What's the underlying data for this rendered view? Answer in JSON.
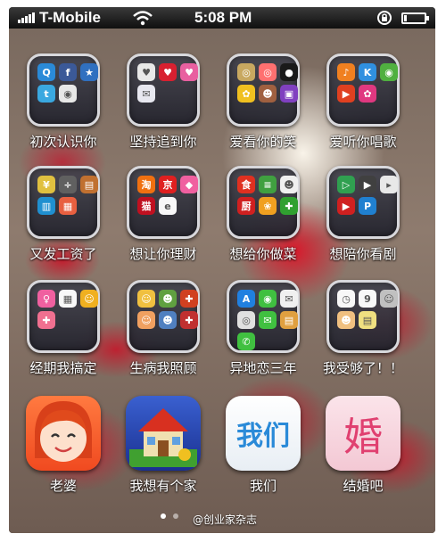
{
  "status_bar": {
    "carrier": "T-Mobile",
    "time": "5:08 PM",
    "battery_level": 0.15
  },
  "folders": [
    {
      "label": "初次认识你",
      "icons": [
        {
          "name": "qq-icon",
          "color": "#2a8ad8",
          "glyph": "Q"
        },
        {
          "name": "facebook-icon",
          "color": "#3b5998",
          "glyph": "f"
        },
        {
          "name": "star-icon",
          "color": "#3070c0",
          "glyph": "★"
        },
        {
          "name": "twitter-icon",
          "color": "#3aa8e0",
          "glyph": "t"
        },
        {
          "name": "owl-icon",
          "color": "#e8e8e8",
          "glyph": "◉"
        }
      ]
    },
    {
      "label": "坚持追到你",
      "icons": [
        {
          "name": "heart-message-icon",
          "color": "#e8e8e8",
          "glyph": "♥"
        },
        {
          "name": "heart-red-icon",
          "color": "#d82030",
          "glyph": "♥"
        },
        {
          "name": "pink-card-icon",
          "color": "#e860a0",
          "glyph": "♥"
        },
        {
          "name": "sms-icon",
          "color": "#e8e8f0",
          "glyph": "✉"
        }
      ]
    },
    {
      "label": "爱看你的笑",
      "icons": [
        {
          "name": "camera-icon",
          "color": "#c8a860",
          "glyph": "◎"
        },
        {
          "name": "beauty-camera-icon",
          "color": "#ff7070",
          "glyph": "◎"
        },
        {
          "name": "lens-icon",
          "color": "#1a1a1a",
          "glyph": "●"
        },
        {
          "name": "sunflower-icon",
          "color": "#f0c020",
          "glyph": "✿"
        },
        {
          "name": "monkey-icon",
          "color": "#a06040",
          "glyph": "☻"
        },
        {
          "name": "photo-icon",
          "color": "#8040c0",
          "glyph": "▣"
        }
      ]
    },
    {
      "label": "爱听你唱歌",
      "icons": [
        {
          "name": "music-icon",
          "color": "#f08020",
          "glyph": "♪"
        },
        {
          "name": "k-song-icon",
          "color": "#3090e0",
          "glyph": "K"
        },
        {
          "name": "record-icon",
          "color": "#50b040",
          "glyph": "◉"
        },
        {
          "name": "player-icon",
          "color": "#e04020",
          "glyph": "▶"
        },
        {
          "name": "flower-music-icon",
          "color": "#e03880",
          "glyph": "✿"
        }
      ]
    },
    {
      "label": "又发工资了",
      "icons": [
        {
          "name": "yen-icon",
          "color": "#e0c040",
          "glyph": "¥"
        },
        {
          "name": "calc-icon",
          "color": "#606060",
          "glyph": "÷"
        },
        {
          "name": "wallet-icon",
          "color": "#c07030",
          "glyph": "▤"
        },
        {
          "name": "bank-icon",
          "color": "#2090d0",
          "glyph": "▥"
        },
        {
          "name": "shop-icon",
          "color": "#e86040",
          "glyph": "▦"
        }
      ]
    },
    {
      "label": "想让你理财",
      "icons": [
        {
          "name": "taobao-icon",
          "color": "#f07010",
          "glyph": "淘"
        },
        {
          "name": "jd-icon",
          "color": "#e02020",
          "glyph": "京"
        },
        {
          "name": "pink-shop-icon",
          "color": "#f060a0",
          "glyph": "◆"
        },
        {
          "name": "tmall-icon",
          "color": "#c01020",
          "glyph": "猫"
        },
        {
          "name": "ebay-icon",
          "color": "#f8f8f8",
          "glyph": "e"
        }
      ]
    },
    {
      "label": "想给你做菜",
      "icons": [
        {
          "name": "recipe-icon",
          "color": "#e03020",
          "glyph": "食"
        },
        {
          "name": "menu-icon",
          "color": "#40a040",
          "glyph": "≡"
        },
        {
          "name": "panda-icon",
          "color": "#f0f0f0",
          "glyph": "☻"
        },
        {
          "name": "kitchen-icon",
          "color": "#d02020",
          "glyph": "厨"
        },
        {
          "name": "veggie-icon",
          "color": "#f0a020",
          "glyph": "❀"
        },
        {
          "name": "cook-icon",
          "color": "#30a030",
          "glyph": "✚"
        }
      ]
    },
    {
      "label": "想陪你看剧",
      "icons": [
        {
          "name": "tv-icon",
          "color": "#30a050",
          "glyph": "▷"
        },
        {
          "name": "clapper-icon",
          "color": "#404040",
          "glyph": "▶"
        },
        {
          "name": "video-icon",
          "color": "#e8e8e8",
          "glyph": "▸"
        },
        {
          "name": "youtube-icon",
          "color": "#d02020",
          "glyph": "▶"
        },
        {
          "name": "p-video-icon",
          "color": "#2080d0",
          "glyph": "P"
        }
      ]
    },
    {
      "label": "经期我搞定",
      "icons": [
        {
          "name": "period-tracker-icon",
          "color": "#f060a0",
          "glyph": "♀"
        },
        {
          "name": "calendar-pink-icon",
          "color": "#f8f8f8",
          "glyph": "▦"
        },
        {
          "name": "girl-icon",
          "color": "#f0b020",
          "glyph": "☺"
        },
        {
          "name": "health-icon",
          "color": "#f07090",
          "glyph": "✚"
        }
      ]
    },
    {
      "label": "生病我照顾",
      "icons": [
        {
          "name": "doctor-icon",
          "color": "#f0c040",
          "glyph": "☺"
        },
        {
          "name": "game-char-icon",
          "color": "#60a040",
          "glyph": "☻"
        },
        {
          "name": "medicine-icon",
          "color": "#d04020",
          "glyph": "✚"
        },
        {
          "name": "nurse-icon",
          "color": "#f0a060",
          "glyph": "☺"
        },
        {
          "name": "cartoon-icon",
          "color": "#5080c0",
          "glyph": "☻"
        },
        {
          "name": "hospital-icon",
          "color": "#c03030",
          "glyph": "✚"
        }
      ]
    },
    {
      "label": "异地恋三年",
      "icons": [
        {
          "name": "app-store-icon",
          "color": "#2080e0",
          "glyph": "A"
        },
        {
          "name": "wechat-icon",
          "color": "#40c040",
          "glyph": "◉"
        },
        {
          "name": "chat-icon",
          "color": "#f0f0f0",
          "glyph": "✉"
        },
        {
          "name": "weibo-icon",
          "color": "#e0e0e0",
          "glyph": "◎"
        },
        {
          "name": "messages-icon",
          "color": "#40c040",
          "glyph": "✉"
        },
        {
          "name": "notes-icon",
          "color": "#e0a040",
          "glyph": "▤"
        },
        {
          "name": "phone-icon",
          "color": "#40c040",
          "glyph": "✆"
        }
      ]
    },
    {
      "label": "我受够了！！",
      "icons": [
        {
          "name": "clock-icon",
          "color": "#f8f8f8",
          "glyph": "◷"
        },
        {
          "name": "calendar-icon",
          "color": "#f8f8f8",
          "glyph": "9"
        },
        {
          "name": "contacts-icon",
          "color": "#c0c0c0",
          "glyph": "☺"
        },
        {
          "name": "avatar-icon",
          "color": "#f0c080",
          "glyph": "☻"
        },
        {
          "name": "notes-yellow-icon",
          "color": "#f0e080",
          "glyph": "▤"
        }
      ]
    }
  ],
  "dock_apps": [
    {
      "label": "老婆",
      "kind": "wife"
    },
    {
      "label": "我想有个家",
      "kind": "house"
    },
    {
      "label": "我们",
      "kind": "women",
      "logo_text": "我们"
    },
    {
      "label": "结婚吧",
      "kind": "marry",
      "logo_text": "婚"
    }
  ],
  "watermark": "@创业家杂志"
}
